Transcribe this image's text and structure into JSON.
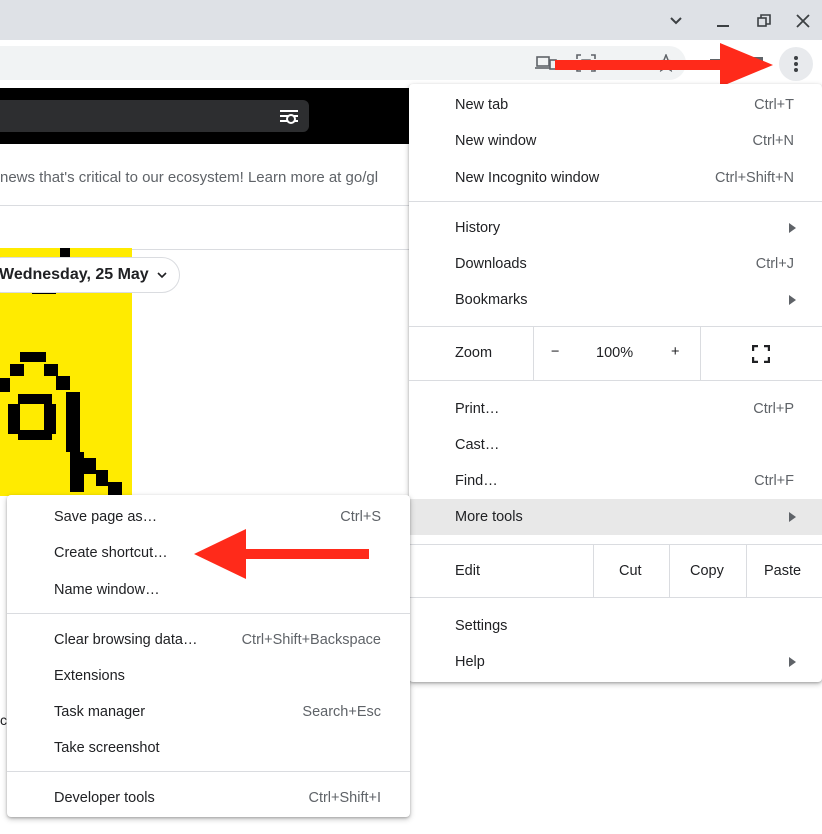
{
  "colors": {
    "accent_arrow": "#ff2a1a",
    "highlight": "#e8e8e8",
    "yellow": "#ffeb00"
  },
  "page": {
    "banner_text": "news that's critical to our ecosystem! Learn more at go/gl",
    "date_chip": "Wednesday, 25 May",
    "stray_text": "c"
  },
  "main_menu": {
    "new_tab": {
      "label": "New tab",
      "shortcut": "Ctrl+T"
    },
    "new_window": {
      "label": "New window",
      "shortcut": "Ctrl+N"
    },
    "new_incognito": {
      "label": "New Incognito window",
      "shortcut": "Ctrl+Shift+N"
    },
    "history": {
      "label": "History"
    },
    "downloads": {
      "label": "Downloads",
      "shortcut": "Ctrl+J"
    },
    "bookmarks": {
      "label": "Bookmarks"
    },
    "zoom": {
      "label": "Zoom",
      "minus": "−",
      "value": "100%",
      "plus": "+"
    },
    "print": {
      "label": "Print…",
      "shortcut": "Ctrl+P"
    },
    "cast": {
      "label": "Cast…"
    },
    "find": {
      "label": "Find…",
      "shortcut": "Ctrl+F"
    },
    "more_tools": {
      "label": "More tools"
    },
    "edit": {
      "label": "Edit",
      "cut": "Cut",
      "copy": "Copy",
      "paste": "Paste"
    },
    "settings": {
      "label": "Settings"
    },
    "help": {
      "label": "Help"
    }
  },
  "sub_menu": {
    "save_page": {
      "label": "Save page as…",
      "shortcut": "Ctrl+S"
    },
    "create_shortcut": {
      "label": "Create shortcut…"
    },
    "name_window": {
      "label": "Name window…"
    },
    "clear_data": {
      "label": "Clear browsing data…",
      "shortcut": "Ctrl+Shift+Backspace"
    },
    "extensions": {
      "label": "Extensions"
    },
    "task_manager": {
      "label": "Task manager",
      "shortcut": "Search+Esc"
    },
    "take_screenshot": {
      "label": "Take screenshot"
    },
    "developer_tools": {
      "label": "Developer tools",
      "shortcut": "Ctrl+Shift+I"
    }
  }
}
